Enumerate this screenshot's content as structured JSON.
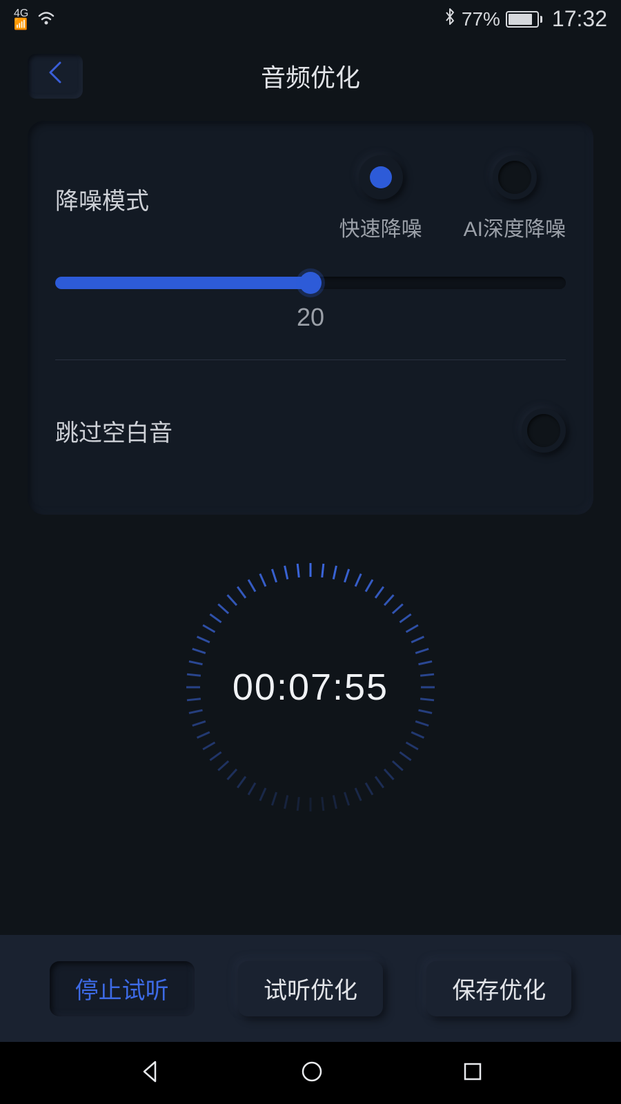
{
  "status": {
    "network": "4G",
    "battery_percent": "77%",
    "time": "17:32"
  },
  "header": {
    "title": "音频优化"
  },
  "noise": {
    "label": "降噪模式",
    "options": {
      "fast": "快速降噪",
      "ai": "AI深度降噪"
    },
    "slider_value": "20"
  },
  "skip": {
    "label": "跳过空白音"
  },
  "timer": {
    "value": "00:07:55"
  },
  "toolbar": {
    "stop": "停止试听",
    "preview": "试听优化",
    "save": "保存优化"
  }
}
